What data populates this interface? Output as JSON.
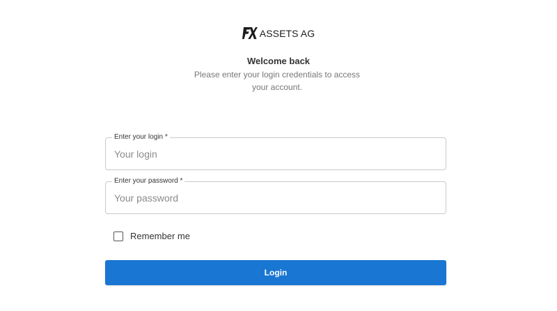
{
  "brand": {
    "logo_icon": "fx-logo-icon",
    "name": "ASSETS AG"
  },
  "heading": {
    "title": "Welcome back",
    "subtitle": "Please enter your login credentials to access your account."
  },
  "form": {
    "login": {
      "label": "Enter your login *",
      "placeholder": "Your login",
      "value": ""
    },
    "password": {
      "label": "Enter your password *",
      "placeholder": "Your password",
      "value": ""
    },
    "remember": {
      "label": "Remember me",
      "checked": false
    },
    "submit_label": "Login"
  },
  "colors": {
    "primary": "#1976d2",
    "text": "#333333",
    "muted": "#777777",
    "border": "#c8c8c8"
  }
}
